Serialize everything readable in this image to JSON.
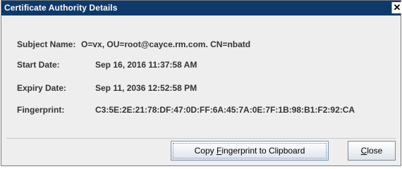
{
  "window": {
    "title": "Certificate Authority Details"
  },
  "fields": [
    {
      "label": "Subject Name:",
      "value": "O=vx, OU=root@cayce.rm.com. CN=nbatd"
    },
    {
      "label": "Start Date:",
      "value": "Sep 16, 2016 11:37:58 AM"
    },
    {
      "label": "Expiry Date:",
      "value": "Sep 11, 2036 12:52:58 PM"
    },
    {
      "label": "Fingerprint:",
      "value": "C3:5E:2E:21:78:DF:47:0D:FF:6A:45:7A:0E:7F:1B:98:B1:F2:92:CA"
    }
  ],
  "buttons": {
    "copy_pre": "Copy ",
    "copy_mnemonic": "F",
    "copy_post": "ingerprint to Clipboard",
    "close_mnemonic": "C",
    "close_post": "lose"
  },
  "icons": {
    "close": "close-x-icon"
  }
}
